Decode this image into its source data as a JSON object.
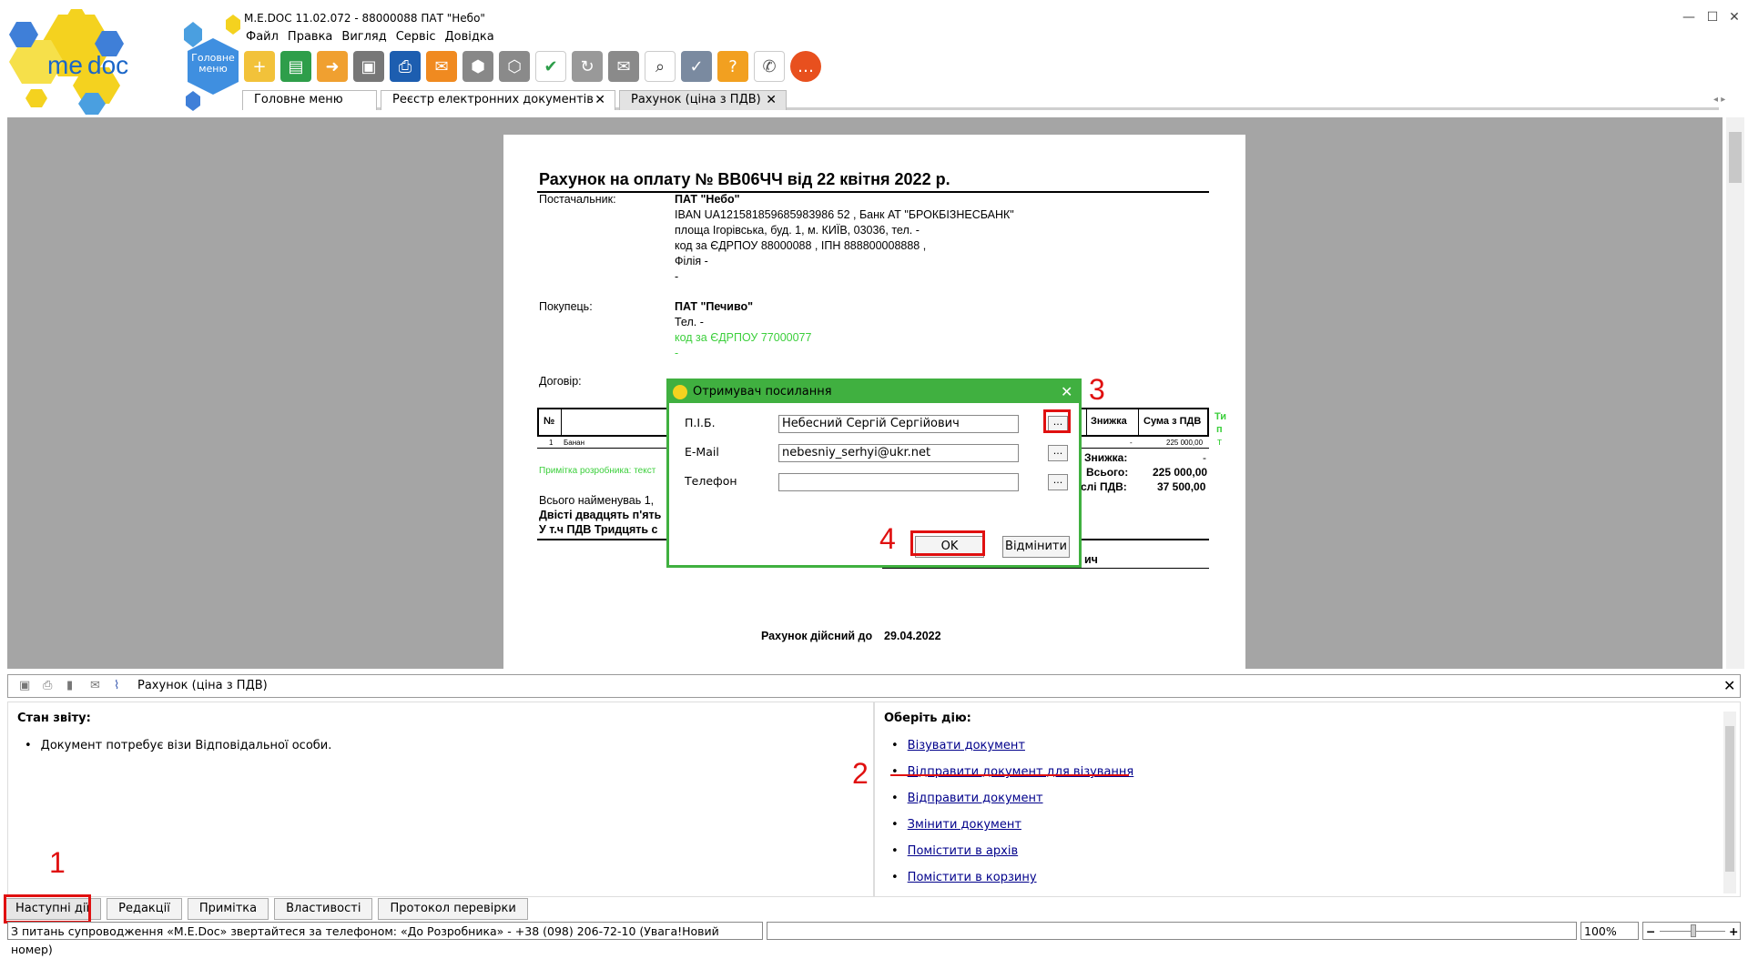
{
  "logo": {
    "text_me": "me",
    "text_doc": "doc",
    "main_menu": "Головне меню"
  },
  "window": {
    "title": "M.E.DOC 11.02.072 - 88000088 ПАТ \"Небо\"",
    "minimize": "—",
    "maximize": "☐",
    "close": "✕"
  },
  "menu": [
    "Файл",
    "Правка",
    "Вигляд",
    "Сервіс",
    "Довідка"
  ],
  "toolbar_icons": [
    "new-document-icon",
    "copy-icon",
    "export-icon",
    "archive-icon",
    "print-icon",
    "send-icon",
    "save-icon",
    "find-icon",
    "sign-icon",
    "refresh-icon",
    "mail-icon",
    "search-icon",
    "security-icon",
    "help-icon",
    "chat-icon",
    "feedback-icon"
  ],
  "tabs": [
    {
      "label": "Головне меню",
      "closable": false
    },
    {
      "label": "Реєстр електронних документів",
      "closable": true,
      "close": "✕"
    },
    {
      "label": "Рахунок (ціна з ПДВ)",
      "closable": true,
      "close": "✕",
      "active": true
    }
  ],
  "document": {
    "title": "Рахунок на оплату № ВВ06ЧЧ від 22 квітня 2022 р.",
    "supplier_label": "Постачальник:",
    "supplier_name": "ПАТ \"Небо\"",
    "supplier_lines": [
      "IBAN UA121581859685983986 52  , Банк АТ \"БРОКБІЗНЕСБАНК\"",
      "площа Ігорівська, буд. 1, м. КИЇВ, 03036, тел. -",
      "код за ЄДРПОУ 88000088 , ІПН 888800008888 ,",
      "Філія -",
      "-"
    ],
    "buyer_label": "Покупець:",
    "buyer_name": "ПАТ \"Печиво\"",
    "buyer_tel": "Тел. -",
    "buyer_code": "код за ЄДРПОУ 77000077",
    "buyer_dash": "-",
    "contract_label": "Договір:",
    "table_no": "№",
    "table_discount": "Знижка",
    "table_sum": "Сума з ПДВ",
    "row_no": "1",
    "row_name": "Банан",
    "row_discount": "-",
    "row_sum": "225 000,00",
    "side_t": "Ти",
    "side_p": "п",
    "side_t2": "т",
    "note_prefix": "Примітка розробника: текст",
    "total_discount_label": "Знижка:",
    "total_discount": "-",
    "total_label": "Всього:",
    "total": "225 000,00",
    "vat_label": "слі ПДВ:",
    "vat": "37 500,00",
    "items_count": "Всього найменуваь  1,",
    "words1": "Двісті двадцять  п'ять",
    "words2": "У т.ч ПДВ  Тридцять с",
    "signer_tail": "ич",
    "valid_label": "Рахунок дійсний до",
    "valid_date": "29.04.2022"
  },
  "dialog": {
    "title": "Отримувач посилання",
    "close": "✕",
    "name_label": "П.І.Б.",
    "name_value": "Небесний Сергій Сергійович",
    "email_label": "E-Mail",
    "email_value": "nebesniy_serhyi@ukr.net",
    "phone_label": "Телефон",
    "phone_value": "",
    "browse": "...",
    "ok": "OK",
    "cancel": "Відмінити"
  },
  "panel": {
    "title": "Рахунок (ціна з ПДВ)",
    "close": "✕",
    "status_title": "Стан звіту:",
    "status_item": "Документ потребує візи Відповідальної особи.",
    "actions_title": "Оберіть дію:",
    "actions": [
      "Візувати документ",
      "Відправити документ для візування",
      "Відправити документ",
      "Змінити документ",
      "Помістити в архів",
      "Помістити в корзину"
    ]
  },
  "bottom_tabs": [
    "Наступні дії",
    "Редакції",
    "Примітка",
    "Властивості",
    "Протокол перевірки"
  ],
  "statusbar": {
    "text": "З питань супроводження «M.E.Doc» звертайтеся за телефоном: «До Розробника» - +38 (098) 206-72-10 (Увага!Новий номер)",
    "zoom": "100%",
    "zoom_minus": "−",
    "zoom_plus": "+"
  },
  "annotations": [
    "1",
    "2",
    "3",
    "4"
  ],
  "colors": {
    "dialog_green": "#40b040",
    "annotation_red": "#e01010",
    "work_gray": "#a5a5a5",
    "link_blue": "#00008b"
  }
}
